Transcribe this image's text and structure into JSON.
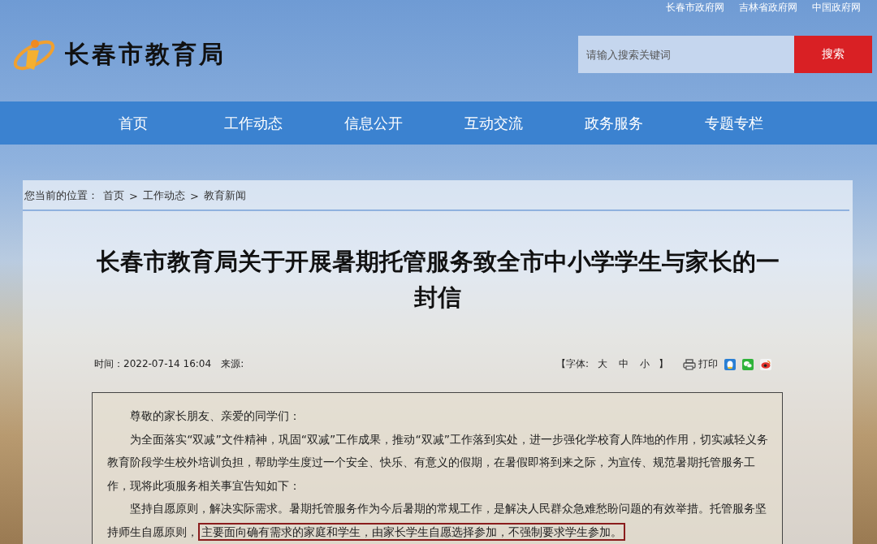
{
  "top_links": [
    "长春市政府网",
    "吉林省政府网",
    "中国政府网"
  ],
  "site_title": "长春市教育局",
  "search": {
    "placeholder": "请输入搜索关键词",
    "button": "搜索"
  },
  "nav": [
    {
      "label": "首页",
      "selected": false
    },
    {
      "label": "工作动态",
      "selected": false
    },
    {
      "label": "信息公开",
      "selected": false
    },
    {
      "label": "互动交流",
      "selected": false
    },
    {
      "label": "政务服务",
      "selected": false
    },
    {
      "label": "专题专栏",
      "selected": false
    }
  ],
  "breadcrumb": {
    "label": "您当前的位置：",
    "items": [
      "首页",
      "工作动态",
      "教育新闻"
    ],
    "separator": ">"
  },
  "article_title": "长春市教育局关于开展暑期托管服务致全市中小学学生与家长的一封信",
  "meta": {
    "time": "时间：2022-07-14 16:04",
    "source": "来源:"
  },
  "font_size": {
    "open": "【字体:",
    "sizes": [
      "大",
      "中",
      "小"
    ],
    "close": "】"
  },
  "print": "打印",
  "greeting": "尊敬的家长朋友、亲爱的同学们：",
  "letter": [
    {
      "text": "为全面落实“双减”文件精神，巩固“双减”工作成果，推动“双减”工作落到实处，进一步强化学校育人阵地的作用，切实减轻义务教育阶段学生校外培训负担，帮助学生度过一个安全、快乐、有意义的假期，在暑假即将到来之际，为宣传、规范暑期托管服务工作，现将此项服务相关事宜告知如下："
    },
    {
      "text": "坚持自愿原则，解决实际需求。暑期托管服务作为今后暑期的常规工作，是解决人民群众急难愁盼问题的有效举措。托管服务坚持师生自愿原则，",
      "highlight": "主要面向确有需求的家庭和学生，由家长学生自愿选择参加，不强制要求学生参加。"
    }
  ]
}
